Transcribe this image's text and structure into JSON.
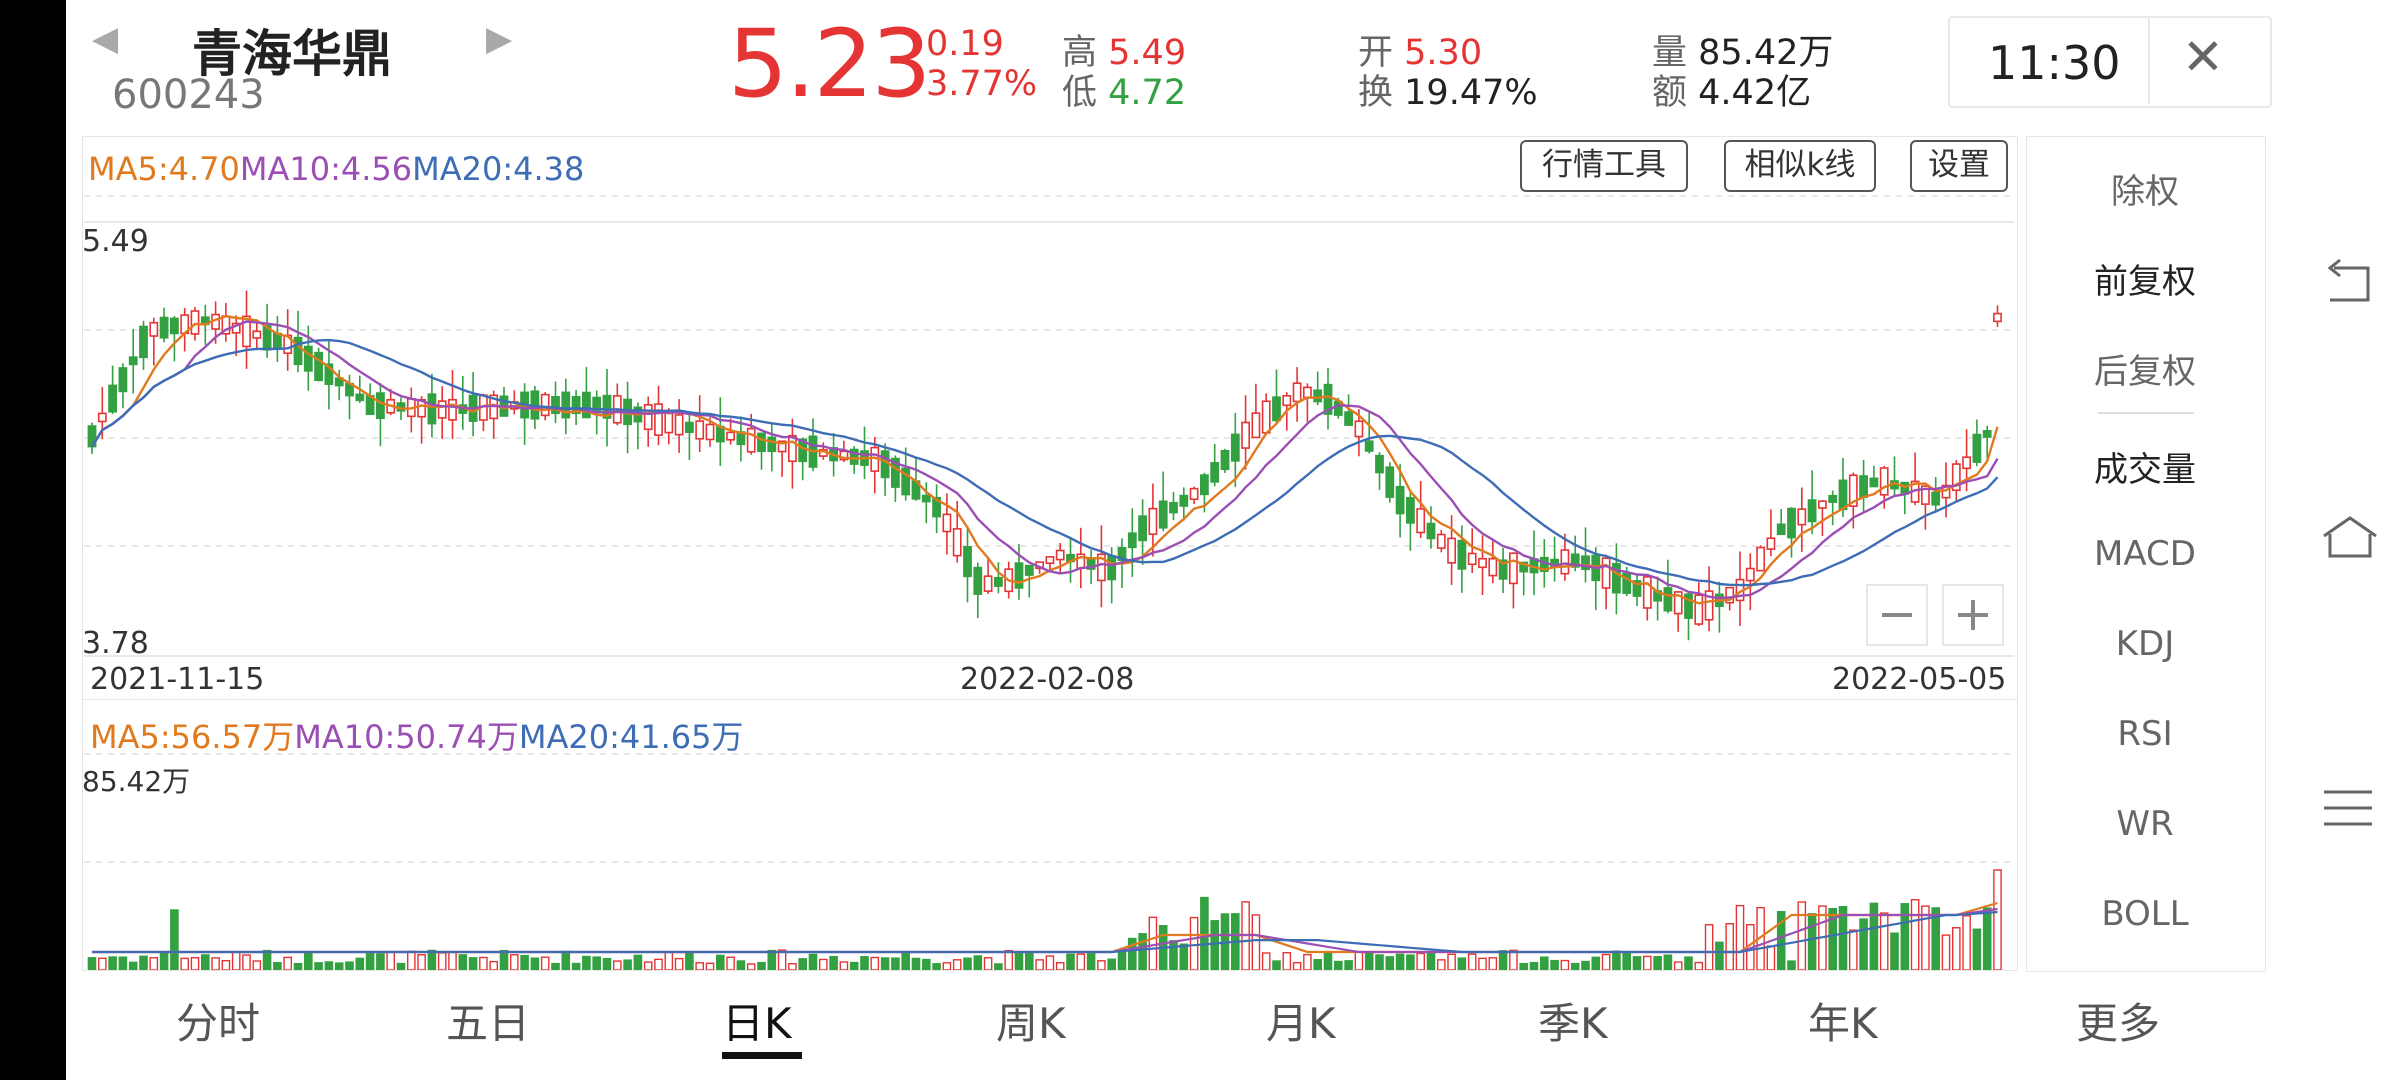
{
  "header": {
    "name": "青海华鼎",
    "code": "600243",
    "price": "5.23",
    "change": "0.19",
    "change_pct": "3.77%",
    "high_label": "高",
    "high": "5.49",
    "low_label": "低",
    "low": "4.72",
    "open_label": "开",
    "open": "5.30",
    "turnover_label": "换",
    "turnover": "19.47%",
    "volume_label": "量",
    "volume": "85.42万",
    "amount_label": "额",
    "amount": "4.42亿",
    "time": "11:30"
  },
  "chart": {
    "ma5": "MA5:4.70",
    "ma10": "MA10:4.56",
    "ma20": "MA20:4.38",
    "y_max": "5.49",
    "y_min": "3.78",
    "dates": [
      "2021-11-15",
      "2022-02-08",
      "2022-05-05"
    ],
    "vol_ma5": "MA5:56.57万",
    "vol_ma10": "MA10:50.74万",
    "vol_ma20": "MA20:41.65万",
    "vol_max": "85.42万"
  },
  "tools": [
    "行情工具",
    "相似k线",
    "设置"
  ],
  "right_menu": [
    "除权",
    "前复权",
    "后复权",
    "成交量",
    "MACD",
    "KDJ",
    "RSI",
    "WR",
    "BOLL"
  ],
  "tabs": [
    "分时",
    "五日",
    "日K",
    "周K",
    "月K",
    "季K",
    "年K",
    "更多"
  ],
  "colors": {
    "up": "#e53434",
    "down": "#33a041",
    "ma5": "#e07a1f",
    "ma10": "#9b4fb5",
    "ma20": "#3e6db5"
  }
}
